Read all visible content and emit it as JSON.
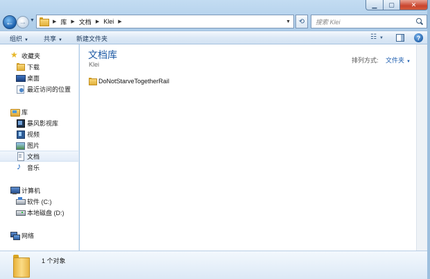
{
  "window": {
    "title_ghost": "Klei"
  },
  "address_bar": {
    "crumbs": [
      "库",
      "文档",
      "Klei"
    ]
  },
  "search": {
    "placeholder": "搜索 Klei"
  },
  "toolbar": {
    "organize": "组织",
    "share": "共享",
    "new_folder": "新建文件夹"
  },
  "nav_pane": {
    "favorites": {
      "label": "收藏夹",
      "items": [
        "下载",
        "桌面",
        "最近访问的位置"
      ]
    },
    "libraries": {
      "label": "库",
      "items": [
        "暴风影视库",
        "视频",
        "图片",
        "文档",
        "音乐"
      ],
      "selected": "文档"
    },
    "computer": {
      "label": "计算机",
      "items": [
        "软件 (C:)",
        "本地磁盘 (D:)"
      ]
    },
    "network": {
      "label": "网络"
    }
  },
  "content": {
    "library_title": "文档库",
    "library_subtitle": "Klei",
    "arrange_label": "排列方式:",
    "arrange_value": "文件夹",
    "files": [
      {
        "name": "DoNotStarveTogetherRail",
        "type": "folder"
      }
    ]
  },
  "details": {
    "object_count": "1 个对象"
  },
  "icons": {
    "accent": "#1e5aa4",
    "folder": "#e2b13b"
  }
}
